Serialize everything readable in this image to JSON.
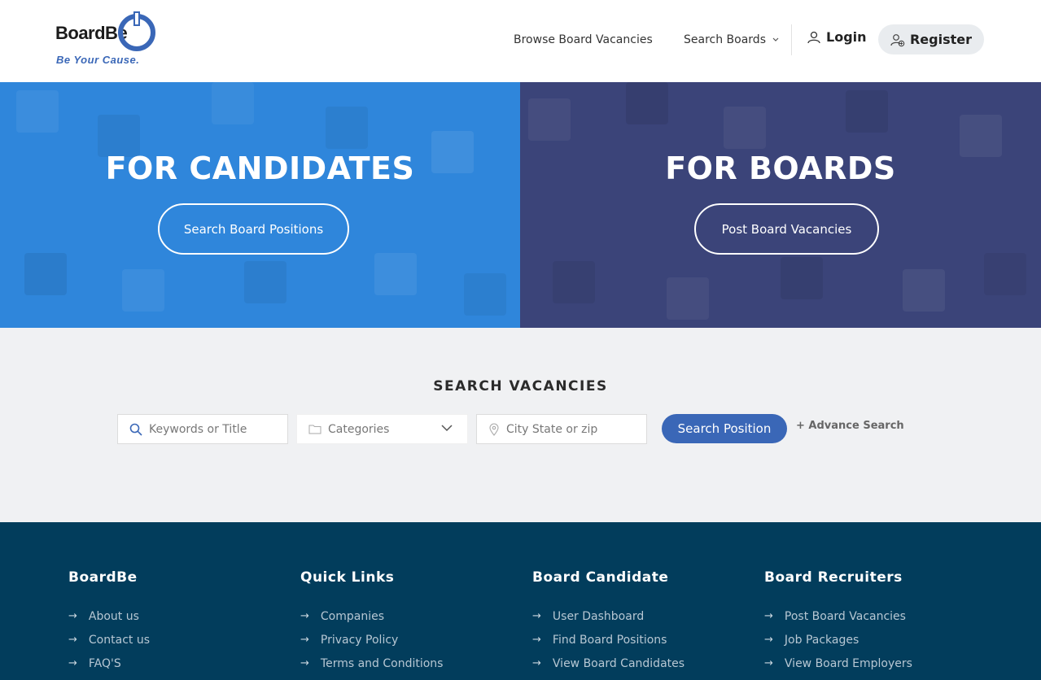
{
  "header": {
    "logo_text": "BoardBe",
    "logo_tagline": "Be Your Cause.",
    "nav": {
      "browse": "Browse Board Vacancies",
      "search_boards": "Search Boards",
      "login": "Login",
      "register": "Register"
    }
  },
  "hero": {
    "left": {
      "title": "FOR CANDIDATES",
      "button": "Search Board Positions"
    },
    "right": {
      "title": "FOR BOARDS",
      "button": "Post Board Vacancies"
    }
  },
  "search": {
    "title": "SEARCH VACANCIES",
    "keywords_placeholder": "Keywords or Title",
    "categories": "Categories",
    "location_placeholder": "City State or zip",
    "button": "Search Position",
    "advance": "+ Advance Search"
  },
  "footer": {
    "columns": [
      {
        "title": "BoardBe",
        "items": [
          "About us",
          "Contact us",
          "FAQ'S"
        ]
      },
      {
        "title": "Quick Links",
        "items": [
          "Companies",
          "Privacy Policy",
          "Terms and Conditions"
        ]
      },
      {
        "title": "Board Candidate",
        "items": [
          "User Dashboard",
          "Find Board Positions",
          "View Board Candidates"
        ]
      },
      {
        "title": "Board Recruiters",
        "items": [
          "Post Board Vacancies",
          "Job Packages",
          "View Board Employers"
        ]
      }
    ]
  },
  "colors": {
    "brand_blue": "#3a67b7",
    "hero_left": "#2f86db",
    "hero_right": "#3b4479",
    "footer_bg": "#023d5c"
  },
  "icons": [
    "user-icon",
    "user-plus-icon",
    "chevron-down-icon",
    "search-icon",
    "folder-icon",
    "map-pin-icon",
    "arrow-right-icon"
  ]
}
